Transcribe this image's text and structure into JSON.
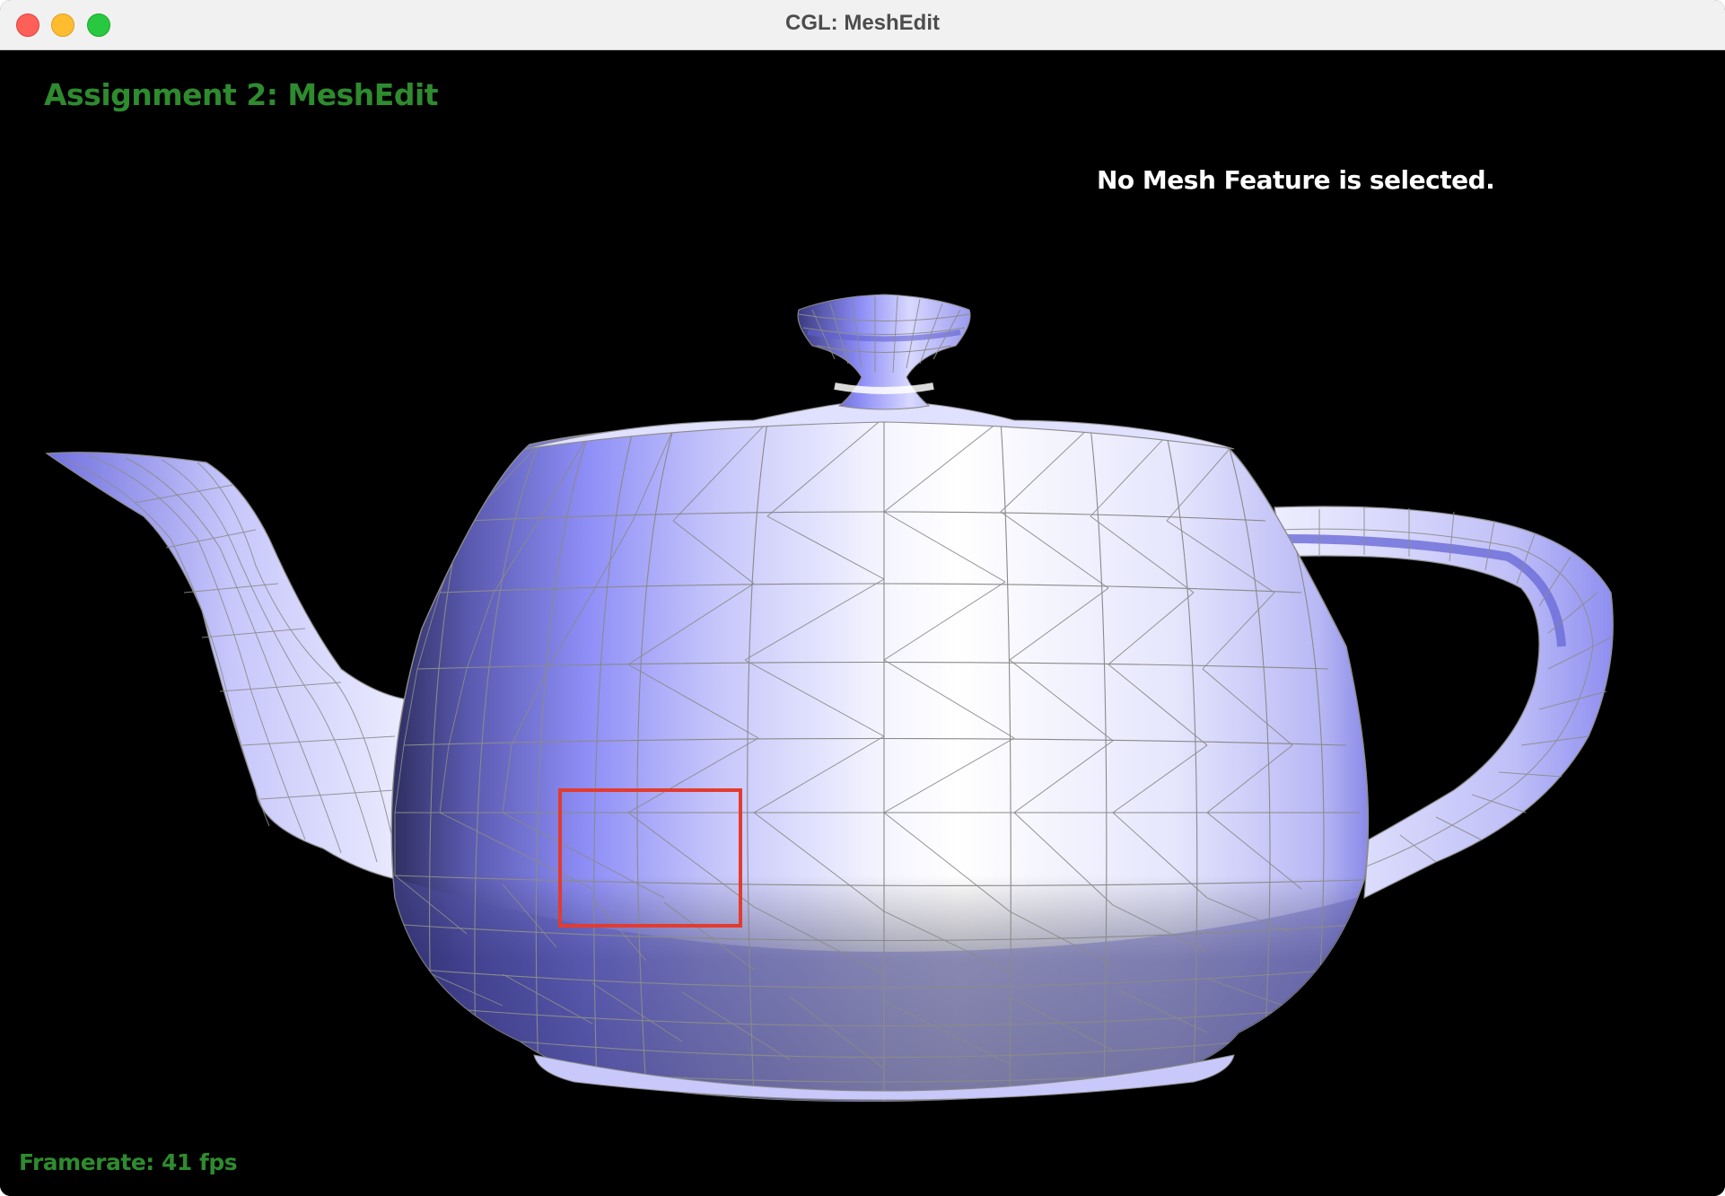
{
  "window": {
    "title": "CGL: MeshEdit"
  },
  "hud": {
    "assignment_title": "Assignment 2: MeshEdit",
    "selection_status": "No Mesh Feature is selected.",
    "framerate": "Framerate: 41 fps"
  },
  "scene": {
    "model": "teapot",
    "shading_base_color": "#8080ff",
    "wireframe_color": "#8c8c8c",
    "highlight_box_color": "#e33b2e"
  }
}
